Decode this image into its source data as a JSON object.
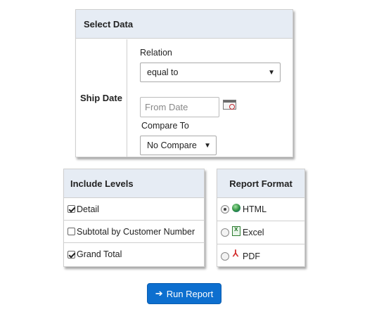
{
  "select_data": {
    "title": "Select Data",
    "ship_date_label": "Ship Date",
    "relation_label": "Relation",
    "relation_value": "equal to",
    "from_date_placeholder": "From Date",
    "compare_to_label": "Compare To",
    "compare_value": "No Compare"
  },
  "include_levels": {
    "title": "Include Levels",
    "items": [
      {
        "label": "Detail",
        "checked": true
      },
      {
        "label": "Subtotal by Customer Number",
        "checked": false
      },
      {
        "label": "Grand Total",
        "checked": true
      }
    ]
  },
  "report_format": {
    "title": "Report Format",
    "options": [
      {
        "label": "HTML",
        "icon": "html-globe-icon",
        "selected": true
      },
      {
        "label": "Excel",
        "icon": "excel-icon",
        "selected": false
      },
      {
        "label": "PDF",
        "icon": "pdf-icon",
        "selected": false
      }
    ]
  },
  "run_button": {
    "label": "Run Report",
    "icon": "arrow-right-icon"
  },
  "colors": {
    "accent": "#0d6fcf",
    "header_bg": "#e6ecf4",
    "border": "#cfcfcf"
  }
}
